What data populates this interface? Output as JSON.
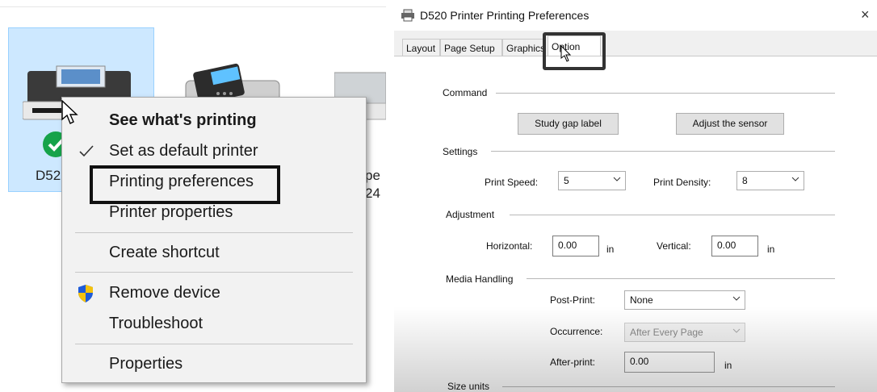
{
  "left": {
    "devices": [
      {
        "label": "D52"
      },
      {
        "label": "pe"
      },
      {
        "label": "24"
      }
    ],
    "context_menu": {
      "items": [
        {
          "label": "See what's printing",
          "bold": true
        },
        {
          "label": "Set as default printer",
          "checked": true
        },
        {
          "label": "Printing preferences"
        },
        {
          "label": "Printer properties"
        },
        {
          "label": "Create shortcut"
        },
        {
          "label": "Remove device",
          "icon": "shield-icon"
        },
        {
          "label": "Troubleshoot"
        },
        {
          "label": "Properties"
        }
      ]
    }
  },
  "dialog": {
    "title": "D520 Printer Printing Preferences",
    "close": "×",
    "tabs": [
      {
        "label": "Layout"
      },
      {
        "label": "Page Setup"
      },
      {
        "label": "Graphics"
      },
      {
        "label": "Option",
        "active": true
      }
    ],
    "command": {
      "group": "Command",
      "study_gap": "Study gap label",
      "adjust_sensor": "Adjust the sensor"
    },
    "settings": {
      "group": "Settings",
      "print_speed_label": "Print Speed:",
      "print_speed_value": "5",
      "print_density_label": "Print Density:",
      "print_density_value": "8"
    },
    "adjustment": {
      "group": "Adjustment",
      "horizontal_label": "Horizontal:",
      "horizontal_value": "0.00",
      "horizontal_unit": "in",
      "vertical_label": "Vertical:",
      "vertical_value": "0.00",
      "vertical_unit": "in"
    },
    "media": {
      "group": "Media Handling",
      "post_print_label": "Post-Print:",
      "post_print_value": "None",
      "occurrence_label": "Occurrence:",
      "occurrence_value": "After Every Page",
      "after_print_label": "After-print:",
      "after_print_value": "0.00",
      "after_print_unit": "in"
    },
    "size_units": {
      "group": "Size units"
    }
  },
  "colors": {
    "selection_bg": "#cde8ff",
    "check_green": "#16a34a",
    "highlight_border": "#111111"
  }
}
